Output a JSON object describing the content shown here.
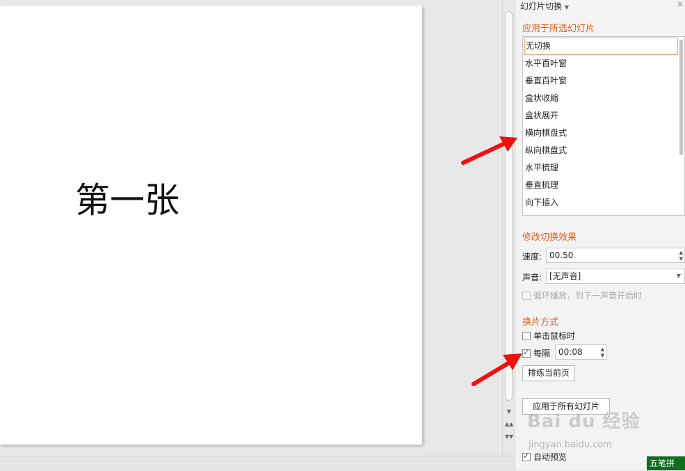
{
  "slide": {
    "title_text": "第一张"
  },
  "panel": {
    "header": "幻灯片切换",
    "header_dropdown": "chevron-down-icon",
    "close_icon": "close-icon",
    "apply_section_title": "应用于所选幻灯片",
    "transitions": [
      "无切换",
      "水平百叶窗",
      "垂直百叶窗",
      "盒状收缩",
      "盒状展开",
      "横向棋盘式",
      "纵向棋盘式",
      "水平梳理",
      "垂直梳理",
      "向下插入"
    ],
    "selected_transition": "无切换",
    "modify_section_title": "修改切换效果",
    "speed_label": "速度:",
    "speed_value": "00.50",
    "sound_label": "声音:",
    "sound_value": "[无声音]",
    "loop_label": "循环播放，到下一声音开始时",
    "advance_section_title": "换片方式",
    "on_click_label": "单击鼠标时",
    "on_click_checked": false,
    "every_label": "每隔",
    "every_checked": true,
    "every_value": "00:08",
    "rehearse_button": "排练当前页",
    "apply_all_button": "应用于所有幻灯片",
    "auto_preview_label": "自动预览",
    "auto_preview_checked": true
  },
  "watermark": {
    "main": "Bai du 经验",
    "sub": "jingyan.baidu.com"
  },
  "ime": {
    "label": "五笔拼"
  },
  "colors": {
    "section_title": "#e06020",
    "arrow": "#ee1111"
  }
}
